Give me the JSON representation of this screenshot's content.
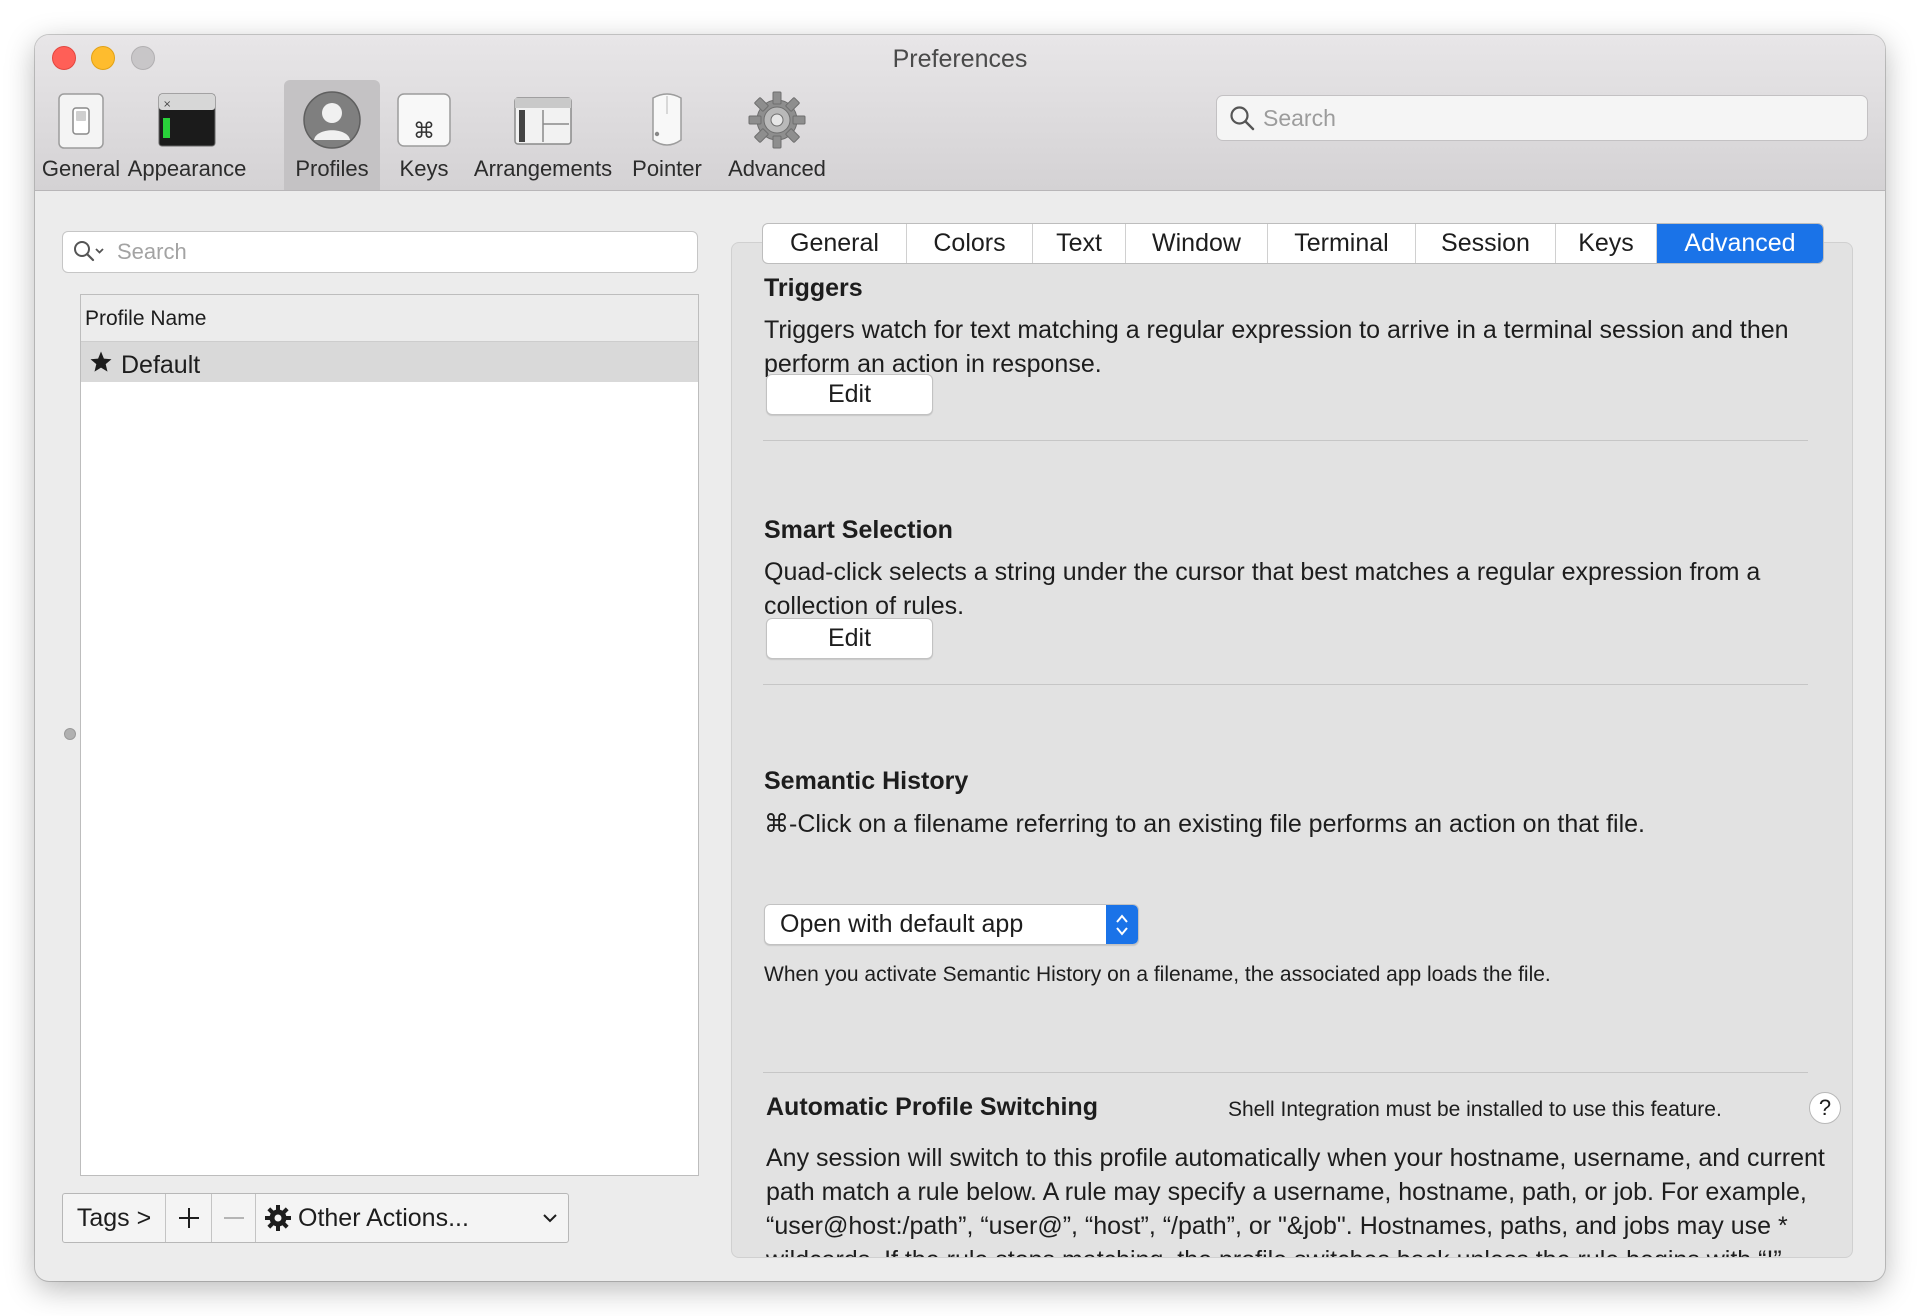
{
  "window": {
    "title": "Preferences"
  },
  "toolbar": {
    "items": [
      {
        "label": "General",
        "icon": "general-switch-icon"
      },
      {
        "label": "Appearance",
        "icon": "terminal-window-icon"
      },
      {
        "label": "Profiles",
        "icon": "person-silhouette-icon"
      },
      {
        "label": "Keys",
        "icon": "command-key-icon"
      },
      {
        "label": "Arrangements",
        "icon": "window-arrangement-icon"
      },
      {
        "label": "Pointer",
        "icon": "mouse-icon"
      },
      {
        "label": "Advanced",
        "icon": "gear-icon"
      }
    ],
    "selected": "Profiles",
    "search_placeholder": "Search"
  },
  "profiles": {
    "search_placeholder": "Search",
    "column_header": "Profile Name",
    "rows": [
      {
        "name": "Default",
        "icon": "star-icon",
        "selected": true
      }
    ],
    "bottom": {
      "tags_label": "Tags >",
      "add_label": "+",
      "remove_label": "—",
      "other_actions_label": "Other Actions..."
    }
  },
  "tabs": {
    "items": [
      "General",
      "Colors",
      "Text",
      "Window",
      "Terminal",
      "Session",
      "Keys",
      "Advanced"
    ],
    "active": "Advanced"
  },
  "triggers": {
    "title": "Triggers",
    "description": "Triggers watch for text matching a regular expression to arrive in a terminal session and then perform an action in response.",
    "button": "Edit"
  },
  "smart_selection": {
    "title": "Smart Selection",
    "description": "Quad-click selects a string under the cursor that best matches a regular expression from a collection of rules.",
    "button": "Edit"
  },
  "semantic_history": {
    "title": "Semantic History",
    "description": "⌘-Click on a filename referring to an existing file performs an action on that file.",
    "selected_option": "Open with default app",
    "note": "When you activate Semantic History on a filename, the associated app loads the file."
  },
  "auto_profile_switching": {
    "title": "Automatic Profile Switching",
    "notice": "Shell Integration must be installed to use this feature.",
    "help_label": "?",
    "description": "Any session will switch to this profile automatically when your hostname, username, and current path match a rule below. A rule may specify a username, hostname, path, or job. For example, “user@host:/path”, “user@”, “host”, “/path”, or \"&job\". Hostnames, paths, and jobs may use * wildcards. If the rule stops matching, the profile switches back unless the rule begins with “!”."
  },
  "colors": {
    "accent": "#1a73e8",
    "close": "#ff5f57",
    "minimize": "#febc2e",
    "maximize_disabled": "#c8c6c8"
  }
}
